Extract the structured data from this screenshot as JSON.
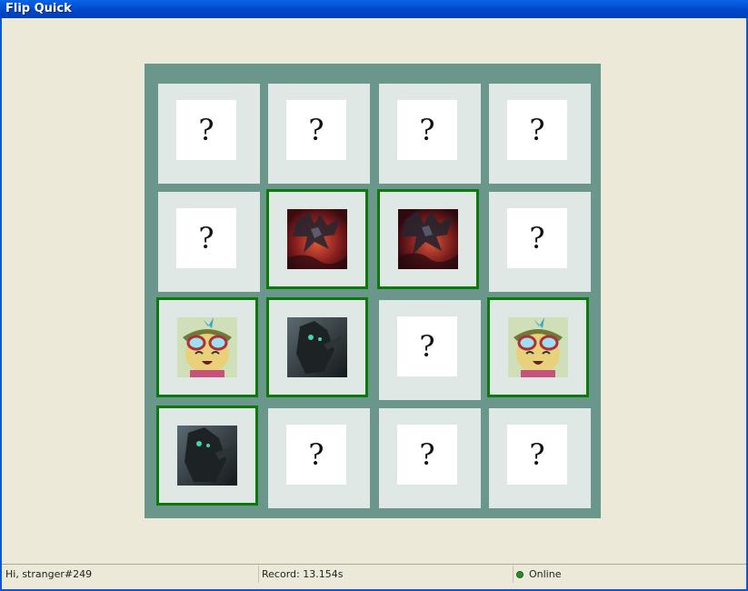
{
  "window": {
    "title": "Flip Quick"
  },
  "board": {
    "cards": [
      {
        "state": "hidden",
        "symbol": "?"
      },
      {
        "state": "hidden",
        "symbol": "?"
      },
      {
        "state": "hidden",
        "symbol": "?"
      },
      {
        "state": "hidden",
        "symbol": "?"
      },
      {
        "state": "hidden",
        "symbol": "?"
      },
      {
        "state": "matched",
        "image": "dark-dragon"
      },
      {
        "state": "matched",
        "image": "dark-dragon"
      },
      {
        "state": "hidden",
        "symbol": "?"
      },
      {
        "state": "matched",
        "image": "yordle-goggles"
      },
      {
        "state": "matched",
        "image": "dark-knight"
      },
      {
        "state": "hidden",
        "symbol": "?"
      },
      {
        "state": "matched",
        "image": "yordle-goggles"
      },
      {
        "state": "matched",
        "image": "dark-knight"
      },
      {
        "state": "hidden",
        "symbol": "?"
      },
      {
        "state": "hidden",
        "symbol": "?"
      },
      {
        "state": "hidden",
        "symbol": "?"
      }
    ]
  },
  "status": {
    "greeting": "Hi, stranger#249",
    "record": "Record: 13.154s",
    "connection": "Online"
  },
  "colors": {
    "board": "#6b968c",
    "matched_border": "#0b7a0b",
    "card_bg": "#e0e8e6"
  }
}
